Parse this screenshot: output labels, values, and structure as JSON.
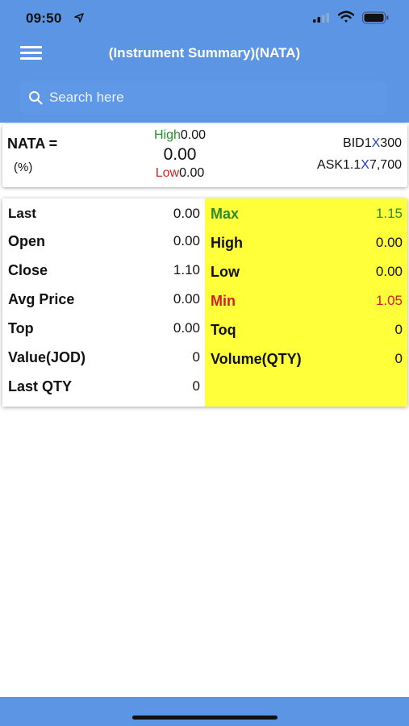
{
  "status_bar": {
    "time": "09:50"
  },
  "nav": {
    "title": "(Instrument Summary)(NATA)"
  },
  "search": {
    "placeholder": "Search here"
  },
  "summary": {
    "symbol_label": "NATA =",
    "percent_label": "(%)",
    "high_label": "High",
    "high_value": "0.00",
    "price": "0.00",
    "low_label": "Low",
    "low_value": "0.00",
    "bid_label": "BID",
    "bid_qty": "1",
    "bid_x": "X",
    "bid_price": "300",
    "ask_label": "ASK",
    "ask_qty": "1.1",
    "ask_x": "X",
    "ask_price": "7,700"
  },
  "stats": {
    "left": [
      {
        "label": "Last",
        "value": "0.00"
      },
      {
        "label": "Open",
        "value": "0.00"
      },
      {
        "label": "Close",
        "value": "1.10"
      },
      {
        "label": "Avg Price",
        "value": "0.00"
      },
      {
        "label": "Top",
        "value": "0.00"
      },
      {
        "label": "Value(JOD)",
        "value": "0"
      },
      {
        "label": "Last QTY",
        "value": "0"
      }
    ],
    "right": [
      {
        "label": "Max",
        "value": "1.15"
      },
      {
        "label": "High",
        "value": "0.00"
      },
      {
        "label": "Low",
        "value": "0.00"
      },
      {
        "label": "Min",
        "value": "1.05"
      },
      {
        "label": "Toq",
        "value": "0"
      },
      {
        "label": "Volume(QTY)",
        "value": "0"
      }
    ]
  },
  "colors": {
    "header": "#5b95e4",
    "panel_yellow": "#ffff3a",
    "positive_green": "#2e8b2e",
    "negative_red": "#d11f1f",
    "x_blue": "#2240cc"
  },
  "icons": [
    "location-arrow-icon",
    "signal-icon",
    "wifi-icon",
    "battery-icon",
    "menu-icon",
    "search-icon"
  ]
}
